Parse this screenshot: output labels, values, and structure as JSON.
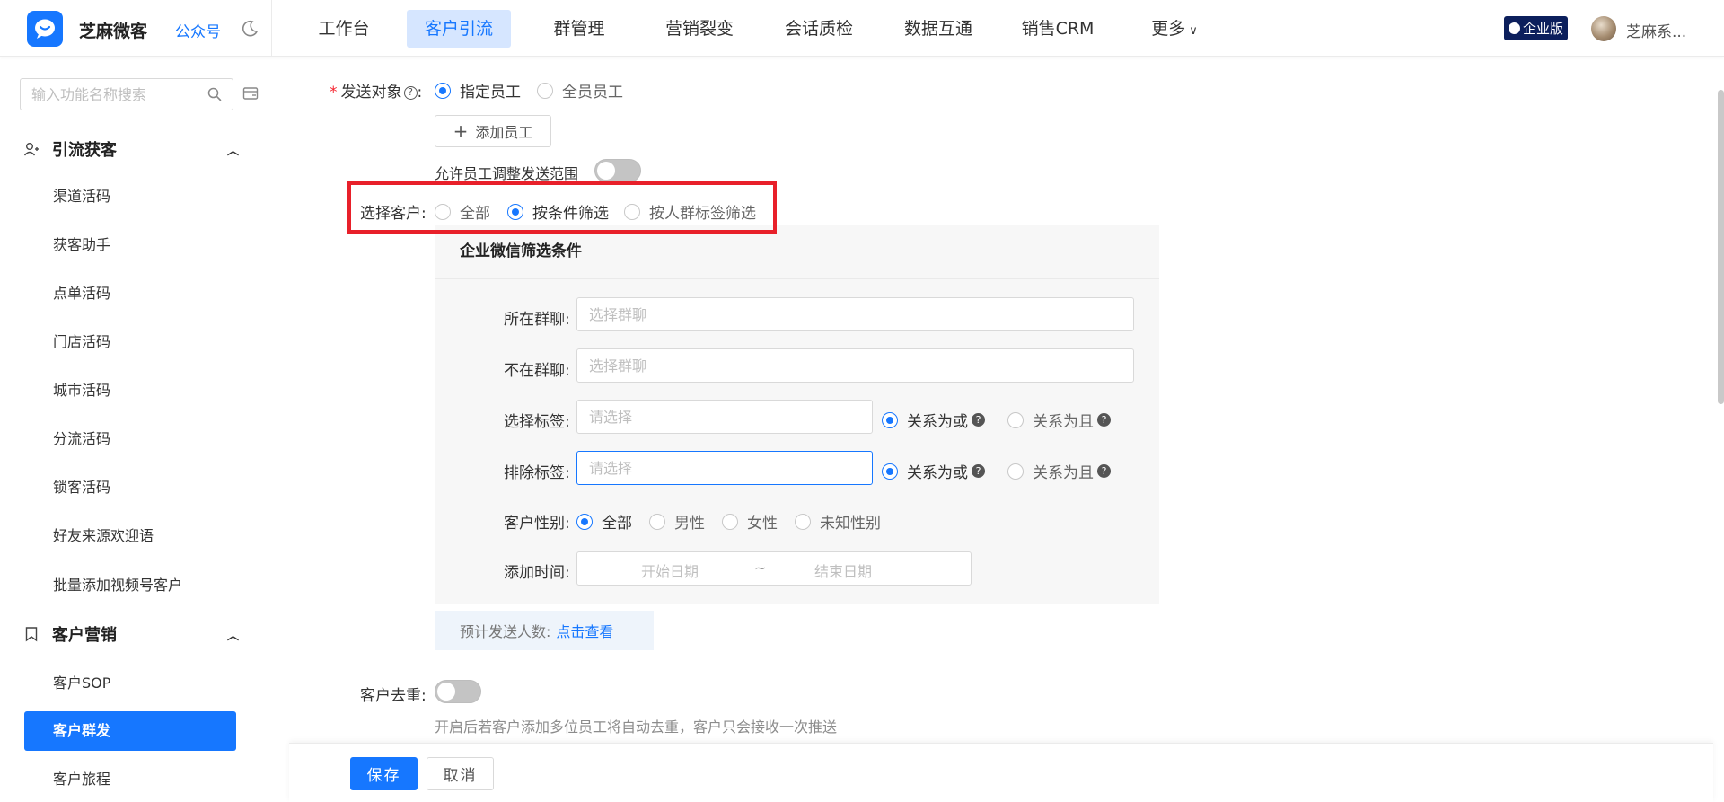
{
  "app": {
    "brand": "芝麻微客",
    "gongzhonghao": "公众号",
    "enterprise_badge": "企业版",
    "user_name": "芝麻系..."
  },
  "nav": {
    "items": [
      {
        "label": "工作台"
      },
      {
        "label": "客户引流",
        "active": true
      },
      {
        "label": "群管理"
      },
      {
        "label": "营销裂变"
      },
      {
        "label": "会话质检"
      },
      {
        "label": "数据互通"
      },
      {
        "label": "销售CRM"
      },
      {
        "label": "更多"
      }
    ]
  },
  "sidebar": {
    "search_placeholder": "输入功能名称搜索",
    "group1": {
      "title": "引流获客",
      "items": [
        "渠道活码",
        "获客助手",
        "点单活码",
        "门店活码",
        "城市活码",
        "分流活码",
        "锁客活码",
        "好友来源欢迎语",
        "批量添加视频号客户"
      ]
    },
    "group2": {
      "title": "客户营销",
      "items": [
        "客户SOP",
        "客户群发",
        "客户旅程"
      ],
      "active_index": 1
    }
  },
  "form": {
    "send_target_label": "发送对象",
    "send_target_options": [
      "指定员工",
      "全员员工"
    ],
    "add_employee": "添加员工",
    "allow_adjust_label": "允许员工调整发送范围",
    "select_customer_label": "选择客户:",
    "select_customer_options": [
      "全部",
      "按条件筛选",
      "按人群标签筛选"
    ],
    "filter": {
      "title": "企业微信筛选条件",
      "in_group_label": "所在群聊:",
      "in_group_placeholder": "选择群聊",
      "not_in_group_label": "不在群聊:",
      "not_in_group_placeholder": "选择群聊",
      "select_tag_label": "选择标签:",
      "select_tag_placeholder": "请选择",
      "exclude_tag_label": "排除标签:",
      "exclude_tag_placeholder": "请选择",
      "relation_or": "关系为或",
      "relation_and": "关系为且",
      "gender_label": "客户性别:",
      "gender_options": [
        "全部",
        "男性",
        "女性",
        "未知性别"
      ],
      "add_time_label": "添加时间:",
      "start_date": "开始日期",
      "date_sep": "~",
      "end_date": "结束日期"
    },
    "estimate_label": "预计发送人数:",
    "estimate_link": "点击查看",
    "dedupe_label": "客户去重:",
    "dedupe_hint": "开启后若客户添加多位员工将自动去重，客户只会接收一次推送"
  },
  "footer": {
    "save": "保存",
    "cancel": "取消"
  },
  "colors": {
    "primary": "#1677ff",
    "highlight": "#e8202a",
    "enterprise_badge_bg": "#0c1f5c"
  }
}
